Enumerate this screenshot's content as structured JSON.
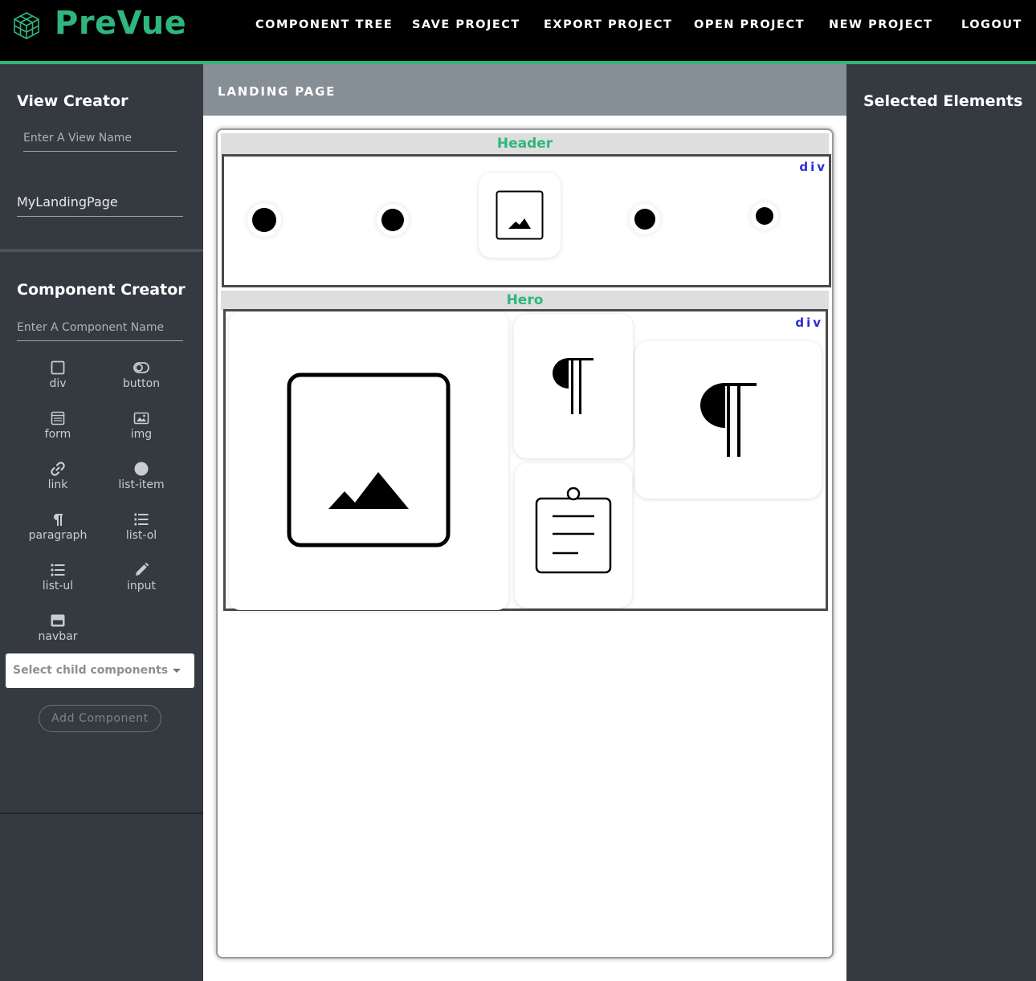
{
  "app": {
    "title": "PreVue"
  },
  "nav": {
    "items": [
      "COMPONENT TREE",
      "SAVE PROJECT",
      "EXPORT PROJECT",
      "OPEN PROJECT",
      "NEW PROJECT",
      "LOGOUT"
    ]
  },
  "sidebar": {
    "view_creator_title": "View Creator",
    "view_name_placeholder": "Enter A View Name",
    "view_name_value": "MyLandingPage",
    "component_creator_title": "Component Creator",
    "component_name_placeholder": "Enter A Component Name",
    "components": [
      {
        "label": "div",
        "icon": "square-icon"
      },
      {
        "label": "button",
        "icon": "toggle-icon"
      },
      {
        "label": "form",
        "icon": "form-icon"
      },
      {
        "label": "img",
        "icon": "image-icon"
      },
      {
        "label": "link",
        "icon": "link-icon"
      },
      {
        "label": "list-item",
        "icon": "circle-icon"
      },
      {
        "label": "paragraph",
        "icon": "paragraph-icon"
      },
      {
        "label": "list-ol",
        "icon": "ordered-list-icon"
      },
      {
        "label": "list-ul",
        "icon": "unordered-list-icon"
      },
      {
        "label": "input",
        "icon": "pencil-icon"
      },
      {
        "label": "navbar",
        "icon": "navbar-icon"
      }
    ],
    "child_select_placeholder": "Select child components",
    "add_button_label": "Add Component"
  },
  "center": {
    "page_label": "LANDING PAGE",
    "sections": [
      {
        "name": "Header",
        "tag": "div"
      },
      {
        "name": "Hero",
        "tag": "div"
      }
    ]
  },
  "right_panel": {
    "title": "Selected Elements"
  },
  "colors": {
    "accent": "#2fb67c",
    "sidebar": "#343a40",
    "tag": "#2b2bd6"
  }
}
